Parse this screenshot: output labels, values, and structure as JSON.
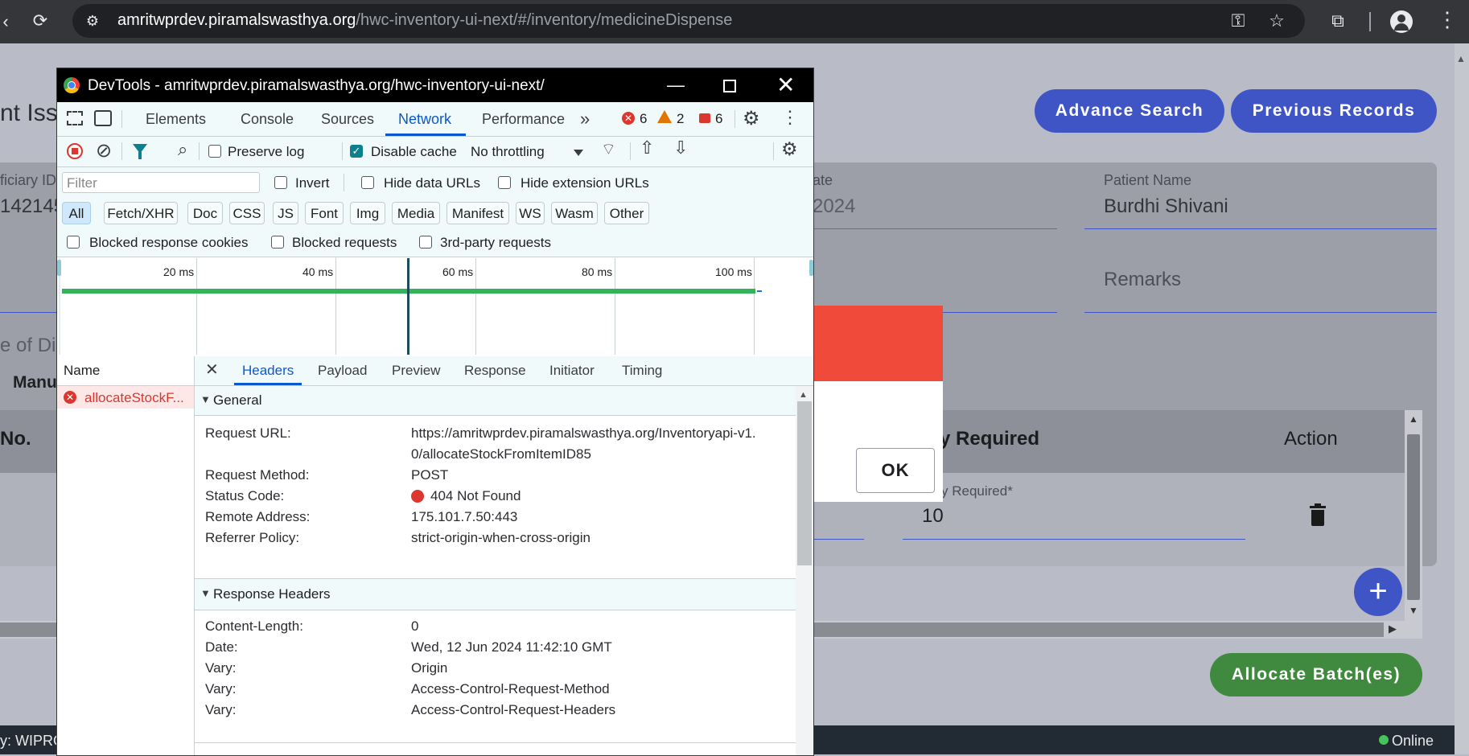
{
  "browser": {
    "url_host": "amritwprdev.piramalswasthya.org",
    "url_path": "/hwc-inventory-ui-next/#/inventory/medicineDispense"
  },
  "app": {
    "page_title_fragment": "nt Issu",
    "advance_search_label": "Advance Search",
    "previous_records_label": "Previous Records",
    "beneficiary_id_label": "ficiary ID",
    "beneficiary_id_value": "142145",
    "date_label": "ate",
    "date_value": "2024",
    "patient_name_label": "Patient Name",
    "patient_name_value": "Burdhi Shivani",
    "remarks_label": "Remarks",
    "dispense_fragment": "e of Disp",
    "manual_fragment": "Manu",
    "table": {
      "col_no": "No.",
      "col_qty": "ty Required",
      "col_action": "Action",
      "qty_field_label": "y Required*",
      "qty_value": "10"
    },
    "allocate_label": "Allocate Batch(es)",
    "footer_left": "y: WIPRO",
    "footer_status": "Online"
  },
  "dialog": {
    "ok_label": "OK"
  },
  "devtools": {
    "title": "DevTools - amritwprdev.piramalswasthya.org/hwc-inventory-ui-next/",
    "tabs": [
      "Elements",
      "Console",
      "Sources",
      "Network",
      "Performance"
    ],
    "errors": "6",
    "warnings": "2",
    "issues": "6",
    "preserve_log": "Preserve log",
    "disable_cache": "Disable cache",
    "throttling": "No throttling",
    "filter_placeholder": "Filter",
    "invert": "Invert",
    "hide_data_urls": "Hide data URLs",
    "hide_ext_urls": "Hide extension URLs",
    "type_filters": [
      "All",
      "Fetch/XHR",
      "Doc",
      "CSS",
      "JS",
      "Font",
      "Img",
      "Media",
      "Manifest",
      "WS",
      "Wasm",
      "Other"
    ],
    "blocked_cookies": "Blocked response cookies",
    "blocked_requests": "Blocked requests",
    "third_party": "3rd-party requests",
    "timeline_ticks": [
      "20 ms",
      "40 ms",
      "60 ms",
      "80 ms",
      "100 ms"
    ],
    "name_header": "Name",
    "request_name": "allocateStockF...",
    "detail_tabs": [
      "Headers",
      "Payload",
      "Preview",
      "Response",
      "Initiator",
      "Timing"
    ],
    "general_title": "General",
    "general": {
      "request_url_label": "Request URL:",
      "request_url_line1": "https://amritwprdev.piramalswasthya.org/Inventoryapi-v1.",
      "request_url_line2": "0/allocateStockFromItemID85",
      "method_label": "Request Method:",
      "method_value": "POST",
      "status_label": "Status Code:",
      "status_value": "404 Not Found",
      "remote_label": "Remote Address:",
      "remote_value": "175.101.7.50:443",
      "referrer_label": "Referrer Policy:",
      "referrer_value": "strict-origin-when-cross-origin"
    },
    "response_headers_title": "Response Headers",
    "response_headers": [
      {
        "key": "Content-Length:",
        "value": "0"
      },
      {
        "key": "Date:",
        "value": "Wed, 12 Jun 2024 11:42:10 GMT"
      },
      {
        "key": "Vary:",
        "value": "Origin"
      },
      {
        "key": "Vary:",
        "value": "Access-Control-Request-Method"
      },
      {
        "key": "Vary:",
        "value": "Access-Control-Request-Headers"
      }
    ]
  }
}
